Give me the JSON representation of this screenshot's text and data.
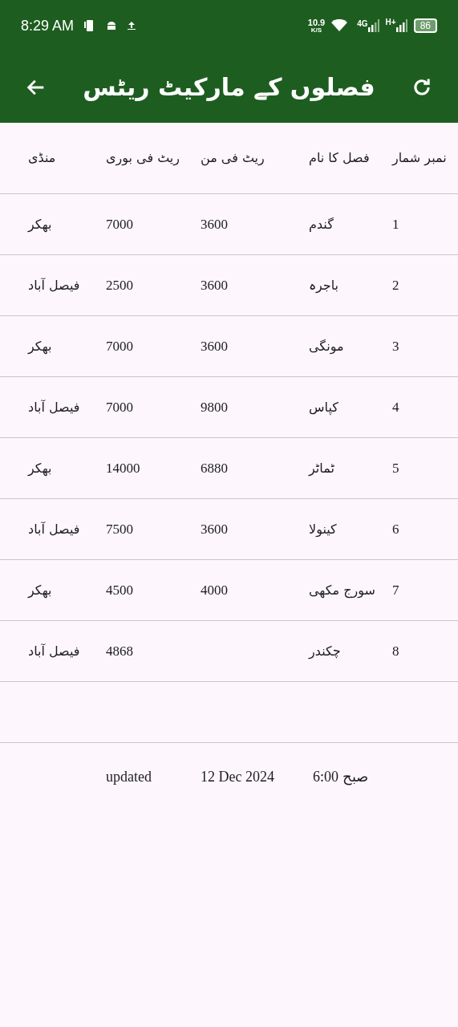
{
  "status_bar": {
    "time": "8:29 AM",
    "speed": "10.9",
    "speed_unit": "K/S",
    "network_1": "4G",
    "network_2": "H+",
    "battery": "86"
  },
  "app_bar": {
    "title": "فصلوں کے مارکیٹ ریٹس"
  },
  "table": {
    "columns": [
      "نمبر شمار",
      "فصل کا نام",
      "ریٹ فی من",
      "ریٹ فی بوری",
      "منڈی"
    ],
    "rows": [
      [
        "1",
        "گندم",
        "3600",
        "7000",
        "بھکر"
      ],
      [
        "2",
        "باجرہ",
        "3600",
        "2500",
        "فیصل آباد"
      ],
      [
        "3",
        "مونگی",
        "3600",
        "7000",
        "بھکر"
      ],
      [
        "4",
        "کپاس",
        "9800",
        "7000",
        "فیصل آباد"
      ],
      [
        "5",
        "ٹماٹر",
        "6880",
        "14000",
        "بھکر"
      ],
      [
        "6",
        "کینولا",
        "3600",
        "7500",
        "فیصل آباد"
      ],
      [
        "7",
        "سورج مکھی",
        "4000",
        "4500",
        "بھکر"
      ],
      [
        "8",
        "چکندر",
        "",
        "4868",
        "فیصل آباد"
      ]
    ]
  },
  "footer": {
    "label": "updated",
    "date": "12 Dec 2024",
    "time": "6:00 صبح"
  }
}
